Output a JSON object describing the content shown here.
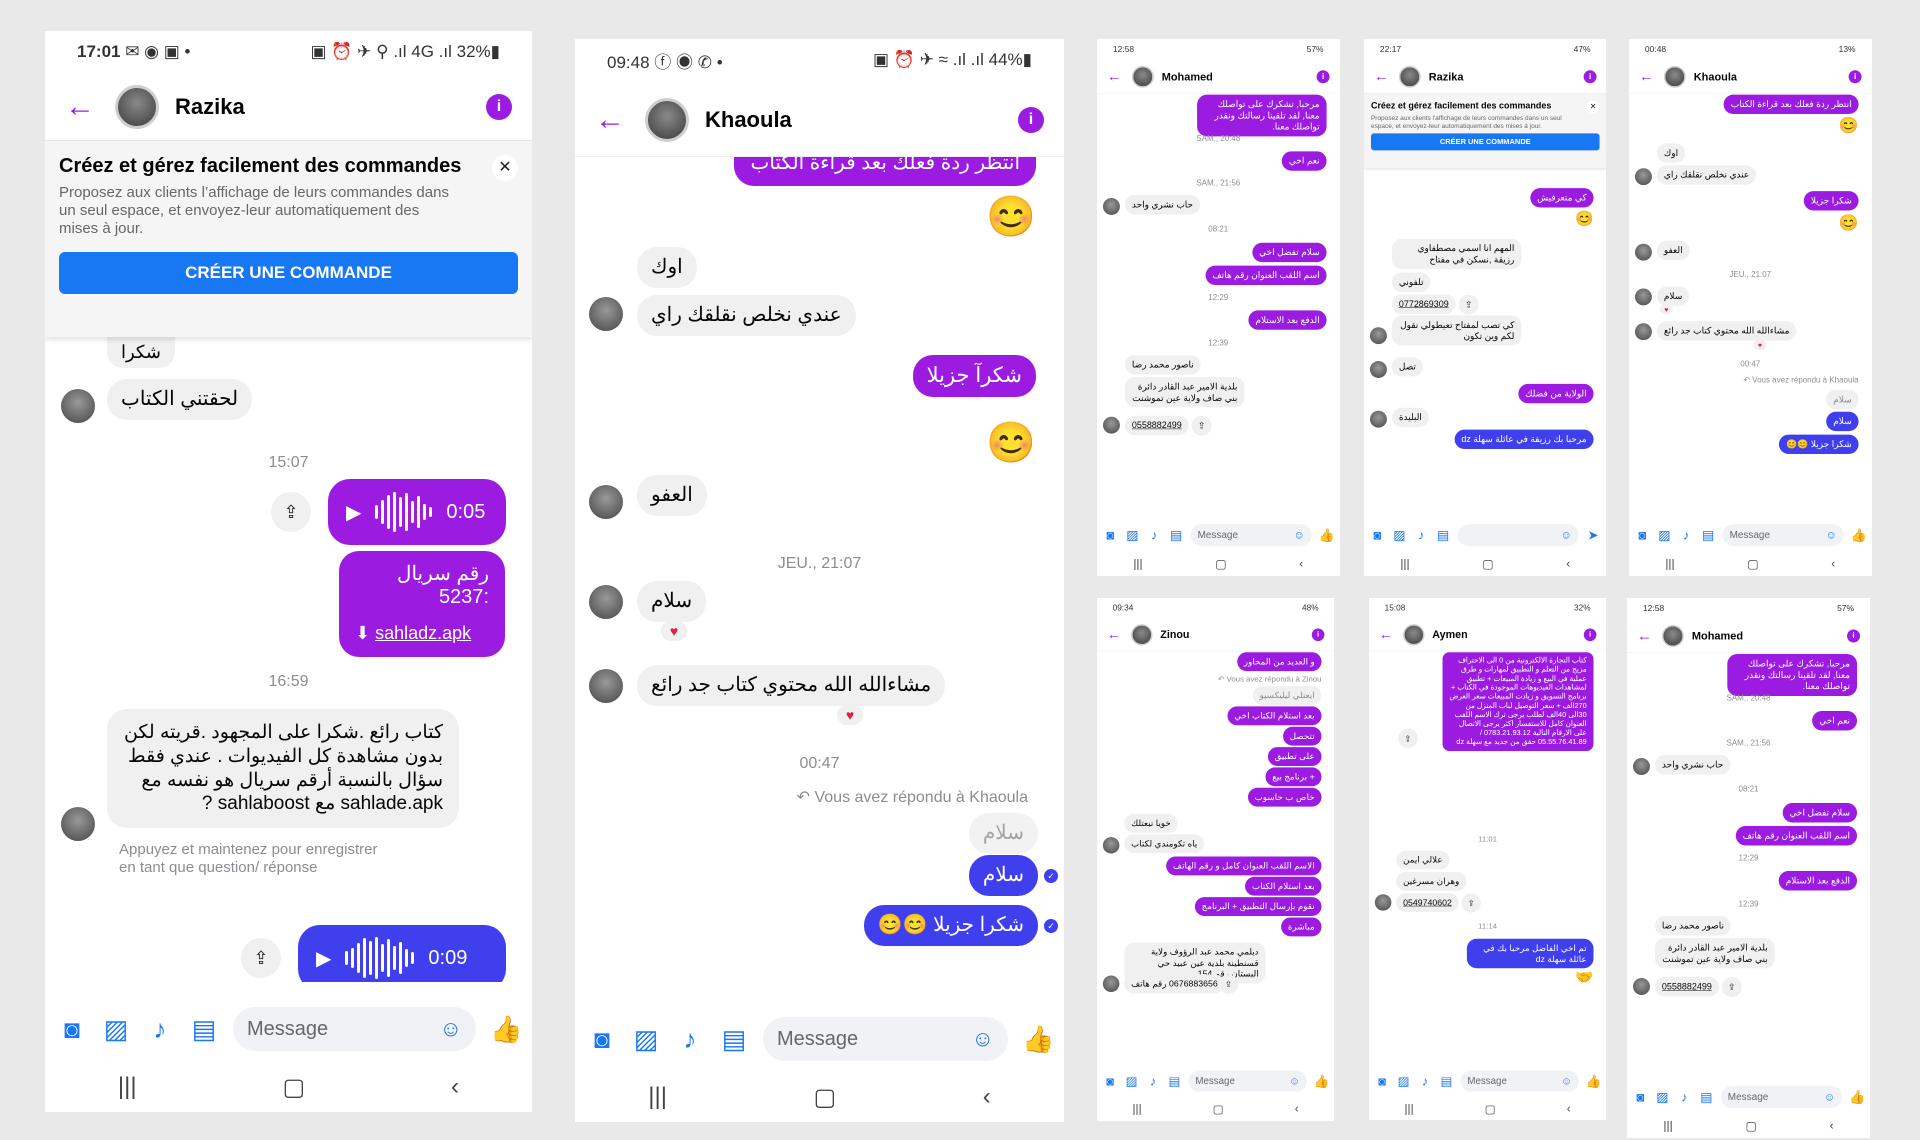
{
  "common": {
    "message_placeholder": "Message"
  },
  "p1": {
    "status_time": "17:01",
    "status_icons": "✉ ◉ ▣ •",
    "status_right": "▣ ⏰ ✈ ⚲ .ıl 4G .ıl 32%▮",
    "contact": "Razika",
    "banner": {
      "title": "Créez et gérez facilement des commandes",
      "desc": "Proposez aux clients l’affichage de leurs commandes dans un seul espace, et envoyez-leur automatiquement des mises à jour.",
      "button": "CRÉER UNE COMMANDE"
    },
    "m1": "شكرا",
    "m2": "لحقتني الكتاب",
    "ts1": "15:07",
    "voice1": "0:05",
    "link_title": "رقم سريال :5237",
    "link": "sahladz.apk",
    "ts2": "16:59",
    "m3": "كتاب رائع .شكرا على المجهود .قريته لكن بدون مشاهدة كل الفيديوات . عندي فقط سؤال بالنسبة أرقم سريال هو نفسه مع sahlade.apk مع sahlaboost ?",
    "note": "Appuyez et maintenez pour enregistrer en tant que question/ réponse",
    "voice2": "0:09"
  },
  "p2": {
    "status_time": "09:48",
    "status_icons": "ⓕ ◉ ✆ •",
    "status_right": "▣ ⏰ ✈ ≈ .ıl .ıl 44%▮",
    "contact": "Khaoula",
    "m0": "انتظر ردة فعلك بعد قراءة الكتاب",
    "m1": "اوك",
    "m2": "عندي نخلص نقلقك راي",
    "m3": "شكرآ جزيلا",
    "m4": "العفو",
    "ts1": "JEU., 21:07",
    "m5": "سلام",
    "m6": "مشاءالله الله  محتوي كتاب جد رائع",
    "ts2": "00:47",
    "reply_note": "↶ Vous avez répondu à Khaoula",
    "quote": "سلام",
    "m7": "سلام",
    "m8": "شكرا جزيلا 😊😊"
  },
  "p3": {
    "status_time": "12:58",
    "status_right": "57%",
    "contact": "Mohamed",
    "m1": "مرحبا, تشكرك على تواصلك معنا, لقد تلقينا رسالتك ونقدر تواصلك معنا.",
    "ts1": "SAM., 20:48",
    "m2": "نعم اخي",
    "ts2": "SAM., 21:56",
    "m3": "حاب نشري واحد",
    "ts3": "08:21",
    "m4": "سلام تفضل اخي",
    "m5": "اسم اللقب العنوان رقم هاتف",
    "ts4": "12:29",
    "m6": "الدفع بعد الاستلام",
    "ts5": "12:39",
    "m7": "ناصور محمد رضا",
    "m8": "بلدية الامير عبد القادر دائرة بني صاف ولاية عين تموشنت",
    "m9": "0558882499"
  },
  "p4": {
    "status_time": "22:17",
    "status_right": "47%",
    "contact": "Razika",
    "banner": {
      "title": "Créez et gérez facilement des commandes",
      "desc": "Proposez aux clients l'affichage de leurs commandes dans un seul espace, et envoyez-leur automatiquement des mises à jour.",
      "button": "CRÉER UNE COMMANDE"
    },
    "m1": "كي متعرفيش",
    "m2": "المهم انا اسمي مصطفاوي رزيقة ,نسكن في مفتاح",
    "m3": "تلفوني",
    "m4": "0772869309",
    "m5": "كي تصب لمفتاح تعيطولي نقول لكم وين تكون",
    "m6": "تصل",
    "m7": "الولاية من فضلك",
    "m8": "البليدة",
    "m9": "مرحبا بك رزيقة في عائلة سهلة dz"
  },
  "p5": {
    "status_time": "00:48",
    "status_right": "13%",
    "contact": "Khaoula",
    "m1": "انتظر ردة فعلك بعد قراءة الكتاب",
    "m2": "اوك",
    "m3": "عندي نخلص نقلقك راي",
    "m4": "شكرا جزيلا",
    "m5": "العفو",
    "ts1": "JEU., 21:07",
    "m6": "سلام",
    "m7": "مشاءالله الله  محتوي كتاب جد رائع",
    "ts2": "00:47",
    "reply_note": "↶ Vous avez répondu à Khaoula",
    "quote": "سلام",
    "m8": "سلام",
    "m9": "شكرا جزيلا 😊😊"
  },
  "p6": {
    "status_time": "09:34",
    "status_right": "48%",
    "contact": "Zinou",
    "m1": "و العديد من المحاور",
    "reply_note": "↶ Vous avez répondu à Zinou",
    "quote": "ايعتلي ليليكسيو",
    "m2": "بعد استلام الكتاب اخي",
    "m3": "تتحصل",
    "m4": "على تطبيق",
    "m5": "+ برنامج بيع",
    "m6": "خاص ب حاسوب",
    "m7": "خويا نبعتلك",
    "m8": "ياه تكومندي لكتاب",
    "m9": "الاسم اللقب العنوان كامل و رقم الهاتف",
    "m10": "بعد استلام الكتاب",
    "m11": "نقوم بإرسال التطبيق + البرنامج",
    "m12": "مباشرة",
    "m13": "ديلمي محمد عبد الرؤوف ولاية قسنطينة بلدية عين عبيد حي البستان رقم 154",
    "m14": "0676883656 رقم هاتف"
  },
  "p7": {
    "status_time": "15:08",
    "status_right": "32%",
    "contact": "Aymen",
    "m1": "كتاب التجارة الالكترونية من 0 الى الاحتراف مزيج من التعلم و التطبيق لمهارات و طرق عملية في البيع و زيادة المبيعات + تطبيق لمشاهدات الفيديوهات الموجودة في الكتاب + برنامج التسويق و زيادت المبيعات سعر العرض 270الف + سعر التوصيل لباب المنزل من 30الى 40الف لطلب يرجى ترك الاسم اللقب العنوان كامل للاستفسار اكثر يرجى الاتصال على الارقام التالية 0783.21.93.12 / 05.55.76.41.89 حقق من جديد مع سهلة dz",
    "ts1": "11:01",
    "m2": "علالي ايمن",
    "m3": "وهران مسرغين",
    "m4": "0549740602",
    "ts2": "11:14",
    "m5": "تم اخي الفاضل مرحبا بك في عائلة سهلة dz"
  },
  "p8": {
    "status_time": "12:58",
    "status_right": "57%",
    "contact": "Mohamed",
    "m1": "مرحبا, تشكرك على تواصلك معنا, لقد تلقينا رسالتك ونقدر تواصلك معنا.",
    "ts1": "SAM., 20:48",
    "m2": "نعم اخي",
    "ts2": "SAM., 21:56",
    "m3": "حاب نشري واحد",
    "ts3": "08:21",
    "m4": "سلام تفضل اخي",
    "m5": "اسم اللقب العنوان رقم هاتف",
    "ts4": "12:29",
    "m6": "الدفع بعد الاستلام",
    "ts5": "12:39",
    "m7": "ناصور محمد رضا",
    "m8": "بلدية الامير عبد القادر دائرة بني صاف ولاية عين تموشنت",
    "m9": "0558882499"
  }
}
